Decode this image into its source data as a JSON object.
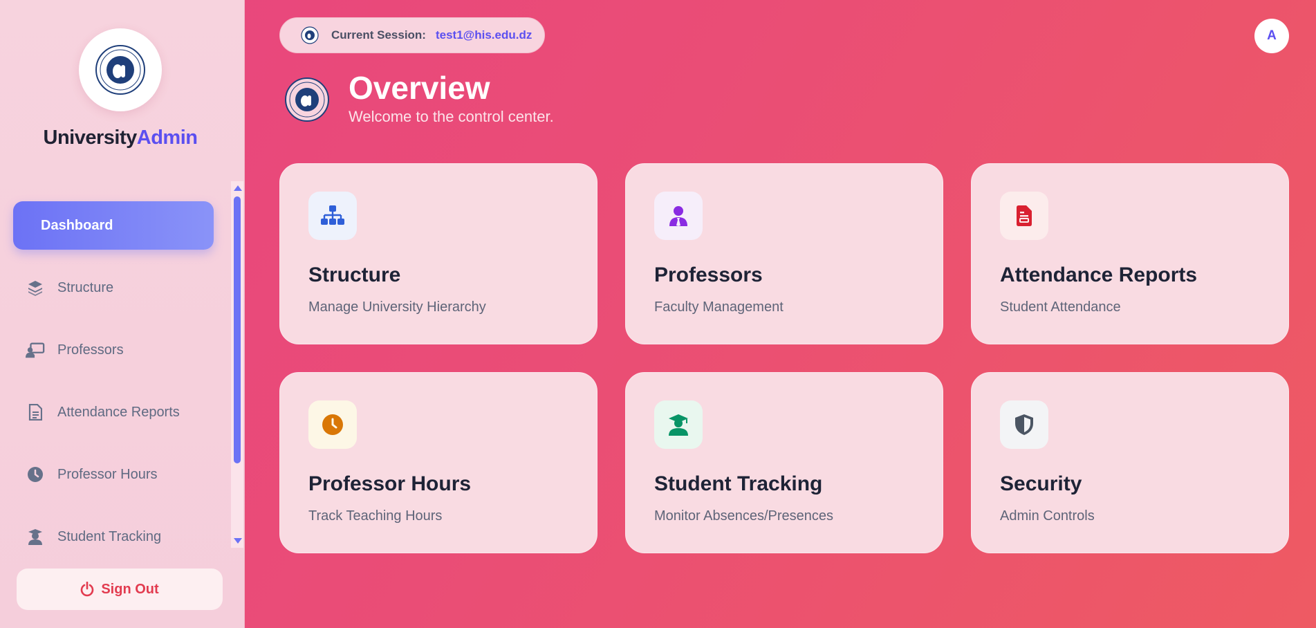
{
  "brand": {
    "part1": "University",
    "part2": "Admin"
  },
  "sidebar": {
    "items": [
      {
        "label": "Dashboard",
        "icon": "dashboard",
        "active": true
      },
      {
        "label": "Structure",
        "icon": "layers-icon"
      },
      {
        "label": "Professors",
        "icon": "chalkboard-teacher-icon"
      },
      {
        "label": "Attendance Reports",
        "icon": "file-lines-icon"
      },
      {
        "label": "Professor Hours",
        "icon": "clock-icon"
      },
      {
        "label": "Student Tracking",
        "icon": "graduate-icon"
      }
    ],
    "signout_label": "Sign Out"
  },
  "session": {
    "label": "Current Session:",
    "value": "test1@his.edu.dz"
  },
  "avatar": {
    "initial": "A"
  },
  "header": {
    "title": "Overview",
    "subtitle": "Welcome to the control center."
  },
  "cards": [
    {
      "title": "Structure",
      "desc": "Manage University Hierarchy",
      "icon": "sitemap-icon",
      "color": "#2f5fd8",
      "bg": "#eef2fc"
    },
    {
      "title": "Professors",
      "desc": "Faculty Management",
      "icon": "user-tie-icon",
      "color": "#8a2be2",
      "bg": "#f6eefa"
    },
    {
      "title": "Attendance Reports",
      "desc": "Student Attendance",
      "icon": "file-icon",
      "color": "#d92030",
      "bg": "#fcecec"
    },
    {
      "title": "Professor Hours",
      "desc": "Track Teaching Hours",
      "icon": "clock-icon",
      "color": "#d97706",
      "bg": "#fdf7e6"
    },
    {
      "title": "Student Tracking",
      "desc": "Monitor Absences/Presences",
      "icon": "graduate-icon",
      "color": "#089466",
      "bg": "#e9f7ef"
    },
    {
      "title": "Security",
      "desc": "Admin Controls",
      "icon": "shield-icon",
      "color": "#4b5563",
      "bg": "#f3f4f6"
    }
  ]
}
